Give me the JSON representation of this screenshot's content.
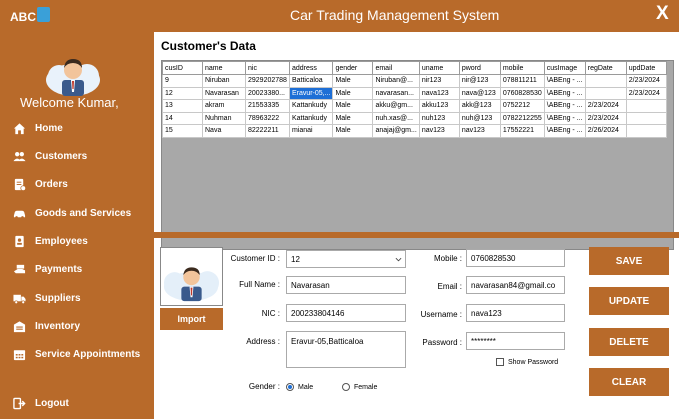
{
  "app": {
    "logo_text": "ABC",
    "title": "Car Trading Management System",
    "close_glyph": "X"
  },
  "sidebar": {
    "welcome": "Welcome  Kumar,",
    "items": [
      {
        "label": "Home",
        "icon": "home-icon"
      },
      {
        "label": "Customers",
        "icon": "customers-icon"
      },
      {
        "label": "Orders",
        "icon": "orders-icon"
      },
      {
        "label": "Goods and Services",
        "icon": "car-icon"
      },
      {
        "label": "Employees",
        "icon": "employee-badge-icon"
      },
      {
        "label": "Payments",
        "icon": "payment-icon"
      },
      {
        "label": "Suppliers",
        "icon": "truck-icon"
      },
      {
        "label": "Inventory",
        "icon": "warehouse-icon"
      },
      {
        "label": "Service Appointments",
        "icon": "calendar-icon"
      }
    ],
    "logout": {
      "label": "Logout",
      "icon": "logout-icon"
    }
  },
  "main": {
    "title": "Customer's Data",
    "table": {
      "columns": [
        "cusID",
        "name",
        "nic",
        "address",
        "gender",
        "email",
        "uname",
        "pword",
        "mobile",
        "cusImage",
        "regDate",
        "updDate"
      ],
      "rows": [
        [
          "9",
          "Niruban",
          "2929202788",
          "Batticaloa",
          "Male",
          "Niruban@...",
          "nir123",
          "nir@123",
          "078811211",
          "\\ABEng - ...",
          "",
          "2/23/2024"
        ],
        [
          "12",
          "Navarasan",
          "20023380...",
          "Eravur-05,...",
          "Male",
          "navarasan...",
          "nava123",
          "nava@123",
          "0760828530",
          "\\ABEng - ...",
          "",
          "2/23/2024"
        ],
        [
          "13",
          "akram",
          "21553335",
          "Kattankudy",
          "Male",
          "akku@gm...",
          "akku123",
          "akk@123",
          "0752212",
          "\\ABEng - ...",
          "2/23/2024",
          ""
        ],
        [
          "14",
          "Nuhman",
          "78963222",
          "Kattankudy",
          "Male",
          "nuh.xas@...",
          "nuh123",
          "nuh@123",
          "0782212255",
          "\\ABEng - ...",
          "2/23/2024",
          ""
        ],
        [
          "15",
          "Nava",
          "82222211",
          "mianai",
          "Male",
          "anajaj@gm...",
          "nav123",
          "nav123",
          "17552221",
          "\\ABEng - ...",
          "2/26/2024",
          ""
        ]
      ]
    }
  },
  "form": {
    "import_label": "Import",
    "customer_id": {
      "label": "Customer ID :",
      "value": "12"
    },
    "full_name": {
      "label": "Full Name :",
      "value": "Navarasan"
    },
    "nic": {
      "label": "NIC :",
      "value": "200233804146"
    },
    "address": {
      "label": "Address :",
      "value": "Eravur-05,Batticaloa"
    },
    "gender": {
      "label": "Gender :",
      "male": "Male",
      "female": "Female",
      "selected": "Male"
    },
    "mobile": {
      "label": "Mobile :",
      "value": "0760828530"
    },
    "email": {
      "label": "Email :",
      "value": "navarasan84@gmail.co"
    },
    "username": {
      "label": "Username :",
      "value": "nava123"
    },
    "password": {
      "label": "Password :",
      "value": "********"
    },
    "show_password": "Show Password"
  },
  "actions": {
    "save": "SAVE",
    "update": "UPDATE",
    "delete": "DELETE",
    "clear": "CLEAR"
  },
  "colors": {
    "accent": "#b86a2a",
    "selection": "#1e6fd6",
    "grid_bg": "#a8a8a8"
  }
}
